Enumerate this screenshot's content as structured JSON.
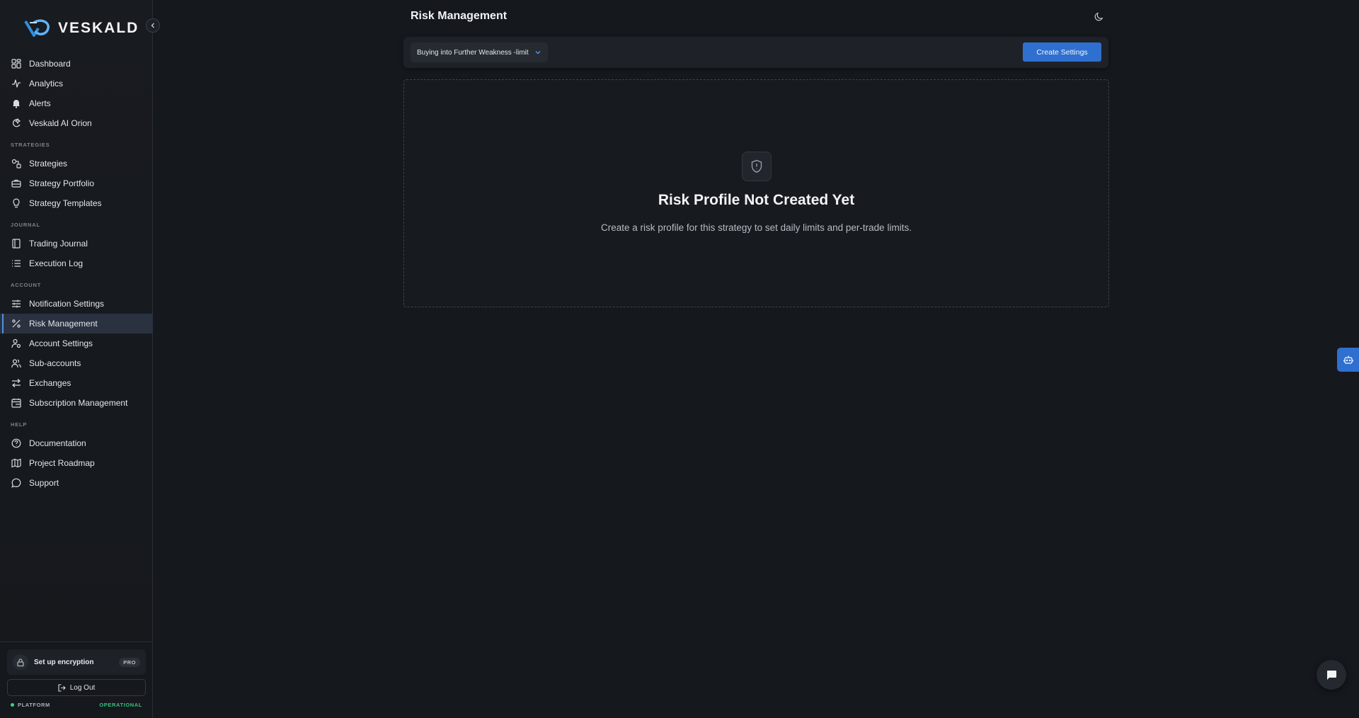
{
  "app": {
    "brand": "VESKALD"
  },
  "sidebar": {
    "items_top": [
      {
        "label": "Dashboard",
        "icon": "dashboard-icon"
      },
      {
        "label": "Analytics",
        "icon": "activity-icon"
      },
      {
        "label": "Alerts",
        "icon": "bell-icon"
      },
      {
        "label": "Veskald AI Orion",
        "icon": "ai-icon"
      }
    ],
    "sections": [
      {
        "title": "STRATEGIES",
        "items": [
          {
            "label": "Strategies",
            "icon": "strategies-icon"
          },
          {
            "label": "Strategy Portfolio",
            "icon": "briefcase-icon"
          },
          {
            "label": "Strategy Templates",
            "icon": "lightbulb-icon"
          }
        ]
      },
      {
        "title": "JOURNAL",
        "items": [
          {
            "label": "Trading Journal",
            "icon": "book-icon"
          },
          {
            "label": "Execution Log",
            "icon": "list-icon"
          }
        ]
      },
      {
        "title": "ACCOUNT",
        "items": [
          {
            "label": "Notification Settings",
            "icon": "sliders-icon"
          },
          {
            "label": "Risk Management",
            "icon": "percent-icon",
            "active": true
          },
          {
            "label": "Account Settings",
            "icon": "user-settings-icon"
          },
          {
            "label": "Sub-accounts",
            "icon": "users-icon"
          },
          {
            "label": "Exchanges",
            "icon": "exchange-icon"
          },
          {
            "label": "Subscription Management",
            "icon": "calendar-icon"
          }
        ]
      },
      {
        "title": "HELP",
        "items": [
          {
            "label": "Documentation",
            "icon": "help-circle-icon"
          },
          {
            "label": "Project Roadmap",
            "icon": "map-icon"
          },
          {
            "label": "Support",
            "icon": "message-icon"
          }
        ]
      }
    ],
    "encryption": {
      "label": "Set up encryption",
      "badge": "PRO",
      "icon": "lock-icon"
    },
    "logout_label": "Log Out",
    "status": {
      "label": "PLATFORM",
      "value": "OPERATIONAL",
      "color": "#35c27e"
    }
  },
  "header": {
    "title": "Risk Management",
    "theme_icon": "moon-icon"
  },
  "toolbar": {
    "strategy_select_value": "Buying into Further Weakness -limit I",
    "create_label": "Create Settings",
    "accent": "#2f6fd0"
  },
  "empty_state": {
    "icon": "shield-alert-icon",
    "title": "Risk Profile Not Created Yet",
    "description": "Create a risk profile for this strategy to set daily limits and per-trade limits."
  },
  "floating": {
    "side_tab_icon": "bot-icon",
    "chat_icon": "chat-icon"
  }
}
